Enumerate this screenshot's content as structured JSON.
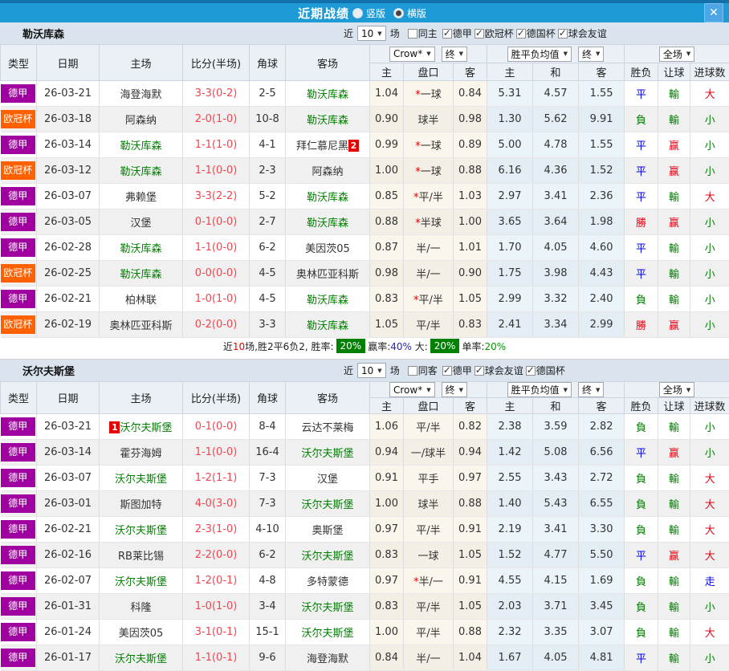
{
  "titlebar": {
    "title": "近期战绩",
    "options": [
      {
        "label": "竖版",
        "selected": false
      },
      {
        "label": "横版",
        "selected": true
      }
    ],
    "close_glyph": "✕"
  },
  "table_header": {
    "main_cols": [
      "类型",
      "日期",
      "主场",
      "比分(半场)",
      "角球",
      "客场"
    ],
    "odds_group": {
      "provider": "Crow*",
      "final": "终",
      "subs": [
        "主",
        "盘口",
        "客"
      ]
    },
    "avg_group": {
      "provider": "胜平负均值",
      "final": "终",
      "subs": [
        "主",
        "和",
        "客"
      ]
    },
    "full_group": {
      "provider": "全场",
      "subs": [
        "胜负",
        "让球",
        "进球数"
      ]
    }
  },
  "sections": [
    {
      "team": "勒沃库森",
      "filter": {
        "prefix": "近",
        "count": "10",
        "suffix": "场",
        "checkboxes": [
          {
            "label": "同主",
            "checked": false
          },
          {
            "label": "德甲",
            "checked": true
          },
          {
            "label": "欧冠杯",
            "checked": true
          },
          {
            "label": "德国杯",
            "checked": true
          },
          {
            "label": "球会友谊",
            "checked": true
          }
        ]
      },
      "rows": [
        {
          "league": "德甲",
          "lc": "purple",
          "date": "26-03-21",
          "home": {
            "name": "海登海默"
          },
          "score": "3-3(0-2)",
          "corners": "2-5",
          "away": {
            "name": "勒沃库森",
            "green": true
          },
          "odds": [
            "1.04",
            "*一球",
            "0.84"
          ],
          "avg": [
            "5.31",
            "4.57",
            "1.55"
          ],
          "res": [
            "平",
            "輸",
            "大"
          ]
        },
        {
          "league": "欧冠杯",
          "lc": "orange",
          "date": "26-03-18",
          "home": {
            "name": "阿森纳"
          },
          "score": "2-0(1-0)",
          "corners": "10-8",
          "away": {
            "name": "勒沃库森",
            "green": true
          },
          "odds": [
            "0.90",
            "球半",
            "0.98"
          ],
          "avg": [
            "1.30",
            "5.62",
            "9.91"
          ],
          "res": [
            "負",
            "輸",
            "小"
          ]
        },
        {
          "league": "德甲",
          "lc": "purple",
          "date": "26-03-14",
          "home": {
            "name": "勒沃库森",
            "green": true
          },
          "score": "1-1(1-0)",
          "corners": "4-1",
          "away": {
            "name": "拜仁慕尼黑",
            "badge": "2",
            "badge_pos": "after"
          },
          "odds": [
            "0.99",
            "*一球",
            "0.89"
          ],
          "avg": [
            "5.00",
            "4.78",
            "1.55"
          ],
          "res": [
            "平",
            "赢",
            "小"
          ]
        },
        {
          "league": "欧冠杯",
          "lc": "orange",
          "date": "26-03-12",
          "home": {
            "name": "勒沃库森",
            "green": true
          },
          "score": "1-1(0-0)",
          "corners": "2-3",
          "away": {
            "name": "阿森纳"
          },
          "odds": [
            "1.00",
            "*一球",
            "0.88"
          ],
          "avg": [
            "6.16",
            "4.36",
            "1.52"
          ],
          "res": [
            "平",
            "赢",
            "小"
          ]
        },
        {
          "league": "德甲",
          "lc": "purple",
          "date": "26-03-07",
          "home": {
            "name": "弗赖堡"
          },
          "score": "3-3(2-2)",
          "corners": "5-2",
          "away": {
            "name": "勒沃库森",
            "green": true
          },
          "odds": [
            "0.85",
            "*平/半",
            "1.03"
          ],
          "avg": [
            "2.97",
            "3.41",
            "2.36"
          ],
          "res": [
            "平",
            "輸",
            "大"
          ]
        },
        {
          "league": "德甲",
          "lc": "purple",
          "date": "26-03-05",
          "home": {
            "name": "汉堡"
          },
          "score": "0-1(0-0)",
          "corners": "2-7",
          "away": {
            "name": "勒沃库森",
            "green": true
          },
          "odds": [
            "0.88",
            "*半球",
            "1.00"
          ],
          "avg": [
            "3.65",
            "3.64",
            "1.98"
          ],
          "res": [
            "勝",
            "赢",
            "小"
          ]
        },
        {
          "league": "德甲",
          "lc": "purple",
          "date": "26-02-28",
          "home": {
            "name": "勒沃库森",
            "green": true
          },
          "score": "1-1(0-0)",
          "corners": "6-2",
          "away": {
            "name": "美因茨05"
          },
          "odds": [
            "0.87",
            "半/一",
            "1.01"
          ],
          "avg": [
            "1.70",
            "4.05",
            "4.60"
          ],
          "res": [
            "平",
            "輸",
            "小"
          ]
        },
        {
          "league": "欧冠杯",
          "lc": "orange",
          "date": "26-02-25",
          "home": {
            "name": "勒沃库森",
            "green": true
          },
          "score": "0-0(0-0)",
          "corners": "4-5",
          "away": {
            "name": "奥林匹亚科斯"
          },
          "odds": [
            "0.98",
            "半/一",
            "0.90"
          ],
          "avg": [
            "1.75",
            "3.98",
            "4.43"
          ],
          "res": [
            "平",
            "輸",
            "小"
          ]
        },
        {
          "league": "德甲",
          "lc": "purple",
          "date": "26-02-21",
          "home": {
            "name": "柏林联"
          },
          "score": "1-0(1-0)",
          "corners": "4-5",
          "away": {
            "name": "勒沃库森",
            "green": true
          },
          "odds": [
            "0.83",
            "*平/半",
            "1.05"
          ],
          "avg": [
            "2.99",
            "3.32",
            "2.40"
          ],
          "res": [
            "負",
            "輸",
            "小"
          ]
        },
        {
          "league": "欧冠杯",
          "lc": "orange",
          "date": "26-02-19",
          "home": {
            "name": "奥林匹亚科斯"
          },
          "score": "0-2(0-0)",
          "corners": "3-3",
          "away": {
            "name": "勒沃库森",
            "green": true
          },
          "odds": [
            "1.05",
            "平/半",
            "0.83"
          ],
          "avg": [
            "2.41",
            "3.34",
            "2.99"
          ],
          "res": [
            "勝",
            "赢",
            "小"
          ]
        }
      ],
      "summary": {
        "segments": [
          {
            "text": "近",
            "style": "plain"
          },
          {
            "text": "10",
            "style": "red"
          },
          {
            "text": "场,胜2平6负2, 胜率:",
            "style": "plain"
          },
          {
            "text": "20%",
            "style": "badge"
          },
          {
            "text": "赢率:",
            "style": "plain"
          },
          {
            "text": "40%",
            "style": "blue"
          },
          {
            "text": " 大:",
            "style": "plain"
          },
          {
            "text": "20%",
            "style": "badge"
          },
          {
            "text": "单率:",
            "style": "plain"
          },
          {
            "text": "20%",
            "style": "green"
          }
        ]
      }
    },
    {
      "team": "沃尔夫斯堡",
      "filter": {
        "prefix": "近",
        "count": "10",
        "suffix": "场",
        "checkboxes": [
          {
            "label": "同客",
            "checked": false
          },
          {
            "label": "德甲",
            "checked": true
          },
          {
            "label": "球会友谊",
            "checked": true
          },
          {
            "label": "德国杯",
            "checked": true
          }
        ]
      },
      "rows": [
        {
          "league": "德甲",
          "lc": "purple",
          "date": "26-03-21",
          "home": {
            "name": "沃尔夫斯堡",
            "green": true,
            "badge": "1",
            "badge_pos": "before"
          },
          "score": "0-1(0-0)",
          "corners": "8-4",
          "away": {
            "name": "云达不莱梅"
          },
          "odds": [
            "1.06",
            "平/半",
            "0.82"
          ],
          "avg": [
            "2.38",
            "3.59",
            "2.82"
          ],
          "res": [
            "負",
            "輸",
            "小"
          ]
        },
        {
          "league": "德甲",
          "lc": "purple",
          "date": "26-03-14",
          "home": {
            "name": "霍芬海姆"
          },
          "score": "1-1(0-0)",
          "corners": "16-4",
          "away": {
            "name": "沃尔夫斯堡",
            "green": true
          },
          "odds": [
            "0.94",
            "一/球半",
            "0.94"
          ],
          "avg": [
            "1.42",
            "5.08",
            "6.56"
          ],
          "res": [
            "平",
            "赢",
            "小"
          ]
        },
        {
          "league": "德甲",
          "lc": "purple",
          "date": "26-03-07",
          "home": {
            "name": "沃尔夫斯堡",
            "green": true
          },
          "score": "1-2(1-1)",
          "corners": "7-3",
          "away": {
            "name": "汉堡"
          },
          "odds": [
            "0.91",
            "平手",
            "0.97"
          ],
          "avg": [
            "2.55",
            "3.43",
            "2.72"
          ],
          "res": [
            "負",
            "輸",
            "大"
          ]
        },
        {
          "league": "德甲",
          "lc": "purple",
          "date": "26-03-01",
          "home": {
            "name": "斯图加特"
          },
          "score": "4-0(3-0)",
          "corners": "7-3",
          "away": {
            "name": "沃尔夫斯堡",
            "green": true
          },
          "odds": [
            "1.00",
            "球半",
            "0.88"
          ],
          "avg": [
            "1.40",
            "5.43",
            "6.55"
          ],
          "res": [
            "負",
            "輸",
            "大"
          ]
        },
        {
          "league": "德甲",
          "lc": "purple",
          "date": "26-02-21",
          "home": {
            "name": "沃尔夫斯堡",
            "green": true
          },
          "score": "2-3(1-0)",
          "corners": "4-10",
          "away": {
            "name": "奥斯堡"
          },
          "odds": [
            "0.97",
            "平/半",
            "0.91"
          ],
          "avg": [
            "2.19",
            "3.41",
            "3.30"
          ],
          "res": [
            "負",
            "輸",
            "大"
          ]
        },
        {
          "league": "德甲",
          "lc": "purple",
          "date": "26-02-16",
          "home": {
            "name": "RB莱比锡"
          },
          "score": "2-2(0-0)",
          "corners": "6-2",
          "away": {
            "name": "沃尔夫斯堡",
            "green": true
          },
          "odds": [
            "0.83",
            "一球",
            "1.05"
          ],
          "avg": [
            "1.52",
            "4.77",
            "5.50"
          ],
          "res": [
            "平",
            "赢",
            "大"
          ]
        },
        {
          "league": "德甲",
          "lc": "purple",
          "date": "26-02-07",
          "home": {
            "name": "沃尔夫斯堡",
            "green": true
          },
          "score": "1-2(0-1)",
          "corners": "4-8",
          "away": {
            "name": "多特蒙德"
          },
          "odds": [
            "0.97",
            "*半/一",
            "0.91"
          ],
          "avg": [
            "4.55",
            "4.15",
            "1.69"
          ],
          "res": [
            "負",
            "輸",
            "走"
          ]
        },
        {
          "league": "德甲",
          "lc": "purple",
          "date": "26-01-31",
          "home": {
            "name": "科隆"
          },
          "score": "1-0(1-0)",
          "corners": "3-4",
          "away": {
            "name": "沃尔夫斯堡",
            "green": true
          },
          "odds": [
            "0.83",
            "平/半",
            "1.05"
          ],
          "avg": [
            "2.03",
            "3.71",
            "3.45"
          ],
          "res": [
            "負",
            "輸",
            "小"
          ]
        },
        {
          "league": "德甲",
          "lc": "purple",
          "date": "26-01-24",
          "home": {
            "name": "美因茨05"
          },
          "score": "3-1(0-1)",
          "corners": "15-1",
          "away": {
            "name": "沃尔夫斯堡",
            "green": true
          },
          "odds": [
            "1.00",
            "平/半",
            "0.88"
          ],
          "avg": [
            "2.32",
            "3.35",
            "3.07"
          ],
          "res": [
            "負",
            "輸",
            "大"
          ]
        },
        {
          "league": "德甲",
          "lc": "purple",
          "date": "26-01-17",
          "home": {
            "name": "沃尔夫斯堡",
            "green": true
          },
          "score": "1-1(0-1)",
          "corners": "9-6",
          "away": {
            "name": "海登海默"
          },
          "odds": [
            "0.84",
            "半/一",
            "1.04"
          ],
          "avg": [
            "1.67",
            "4.05",
            "4.81"
          ],
          "res": [
            "平",
            "輸",
            "小"
          ]
        }
      ]
    }
  ],
  "colors": {
    "titlebar_blue": "#1E9BD7",
    "titlebar_dark": "#1470A8",
    "close_btn_blue": "#4DA6E6",
    "section_bar_bg": "#D9E4EE",
    "header_bg": "#EAF0F6",
    "league_purple": "#A000A0",
    "league_orange": "#FF6000",
    "team_green": "#008000",
    "score_red": "#F4444E",
    "res_red": "#E60012",
    "res_green": "#008000",
    "res_blue": "#0000E6",
    "cream_col": "#FBF6EC",
    "blue_col": "#EAF4F9",
    "row_alt": "#F0F0F0",
    "badge_green": "#008000",
    "badge_red": "#E60000",
    "pct_blue": "#2222CC",
    "pct_green": "#009900"
  }
}
